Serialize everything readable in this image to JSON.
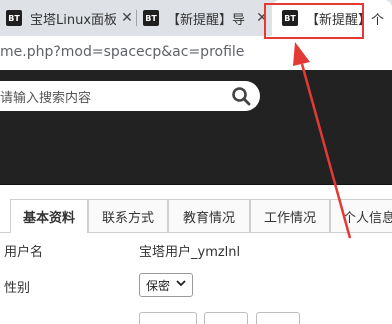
{
  "browser": {
    "tabs": [
      {
        "favicon": "BT",
        "title": "宝塔Linux面板",
        "close": "✕"
      },
      {
        "favicon": "BT",
        "title": "【新提醒】导",
        "close": "✕"
      },
      {
        "favicon": "BT",
        "title": "【新提醒】个",
        "close": ""
      }
    ],
    "url": "me.php?mod=spacecp&ac=profile"
  },
  "site": {
    "search_placeholder": "请输入搜索内容",
    "search_icon": "search-icon"
  },
  "profile": {
    "tabs": [
      "基本资料",
      "联系方式",
      "教育情况",
      "工作情况",
      "个人信息"
    ],
    "active_tab": "基本资料",
    "fields": {
      "username_label": "用户名",
      "username_value": "宝塔用户_ymzlnl",
      "gender_label": "性别",
      "gender_value": "保密"
    }
  },
  "colors": {
    "annotation": "#e53935",
    "header_bg": "#222222",
    "tabstrip_bg": "#dee1e6"
  }
}
